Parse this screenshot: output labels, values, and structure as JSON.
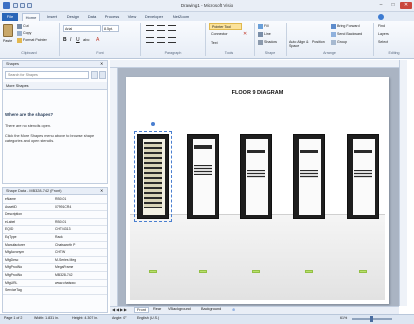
{
  "window": {
    "title": "Drawing1 - Microsoft Visio",
    "minimize": "–",
    "maximize": "□",
    "close": "✕"
  },
  "ribbon_tabs": [
    "File",
    "Home",
    "Insert",
    "Design",
    "Data",
    "Process",
    "View",
    "Developer",
    "NetZoom"
  ],
  "ribbon": {
    "clipboard": {
      "cut": "Cut",
      "copy": "Copy",
      "paste": "Paste",
      "format_painter": "Format Painter",
      "label": "Clipboard"
    },
    "font": {
      "family": "Arial",
      "size": "8.5pt.",
      "label": "Font"
    },
    "paragraph": {
      "label": "Paragraph"
    },
    "tools": {
      "pointer": "Pointer Tool",
      "connector": "Connector",
      "text": "Text",
      "label": "Tools"
    },
    "shape": {
      "fill": "Fill",
      "line": "Line",
      "shadow": "Shadow",
      "label": "Shape"
    },
    "arrange": {
      "auto_align": "Auto Align & Space",
      "position": "Position",
      "bring_forward": "Bring Forward",
      "send_backward": "Send Backward",
      "group": "Group",
      "label": "Arrange"
    },
    "editing": {
      "find": "Find",
      "layers": "Layers",
      "select": "Select",
      "label": "Editing"
    }
  },
  "shapes_panel": {
    "title": "Shapes",
    "search_placeholder": "Search for Shapes",
    "more_shapes": "More Shapes",
    "where_heading": "Where are the shapes?",
    "no_stencils": "There are no stencils open.",
    "hint": "Click the More Shapes menu above to browse shape categories and open stencils."
  },
  "shape_data": {
    "title": "Shape Data - MB328-742 (Front)",
    "rows": [
      {
        "key": "eName",
        "value": "RB0.01"
      },
      {
        "key": "AssetID",
        "value": "07991CR4"
      },
      {
        "key": "Description",
        "value": ""
      },
      {
        "key": "eLabel",
        "value": "RB0.01"
      },
      {
        "key": "EQID",
        "value": "CHT/4313"
      },
      {
        "key": "EqType",
        "value": "Rack"
      },
      {
        "key": "Manufacturer",
        "value": "Chatsworth P"
      },
      {
        "key": "MfgAcronym",
        "value": "CHTW"
      },
      {
        "key": "MfgDesc",
        "value": "M-Series Meg"
      },
      {
        "key": "MfgProdNo",
        "value": "MegaFrame"
      },
      {
        "key": "MfgProdNo",
        "value": "MB328-742"
      },
      {
        "key": "MfgURL",
        "value": "www.chatswo"
      },
      {
        "key": "ServiceTag",
        "value": ""
      }
    ]
  },
  "diagram": {
    "title": "FLOOR 9 DIAGRAM"
  },
  "page_tabs": {
    "tabs": [
      "Front",
      "Rear",
      "VBackground",
      "Background"
    ]
  },
  "status": {
    "page": "Page 1 of 2",
    "width": "Width: 1.831 in.",
    "height": "Height: 4.307 in.",
    "angle": "Angle: 0°",
    "language": "English (U.S.)",
    "zoom": "61%"
  },
  "colors": {
    "accent": "#2a66b8",
    "canvas": "#aab4c3",
    "tag": "#b8e06a"
  }
}
